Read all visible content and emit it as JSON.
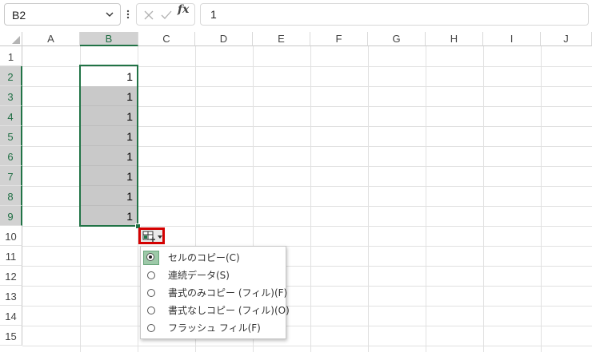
{
  "formula_bar": {
    "name_box": "B2",
    "formula_value": "1",
    "fx_label": "fx"
  },
  "columns": [
    "A",
    "B",
    "C",
    "D",
    "E",
    "F",
    "G",
    "H",
    "I",
    "J"
  ],
  "selected_column": "B",
  "rows": [
    "1",
    "2",
    "3",
    "4",
    "5",
    "6",
    "7",
    "8",
    "9",
    "10",
    "11",
    "12",
    "13",
    "14",
    "15"
  ],
  "cells_b": [
    "1",
    "1",
    "1",
    "1",
    "1",
    "1",
    "1",
    "1"
  ],
  "autofill_menu": {
    "items": [
      {
        "label": "セルのコピー(C)",
        "checked": true
      },
      {
        "label": "連続データ(S)",
        "checked": false
      },
      {
        "label": "書式のみコピー (フィル)(F)",
        "checked": false
      },
      {
        "label": "書式なしコピー (フィル)(O)",
        "checked": false
      },
      {
        "label": "フラッシュ フィル(F)",
        "checked": false
      }
    ]
  },
  "colors": {
    "accent": "#217346",
    "highlight_border": "#d40000",
    "selection_fill": "#c9c9c9"
  }
}
